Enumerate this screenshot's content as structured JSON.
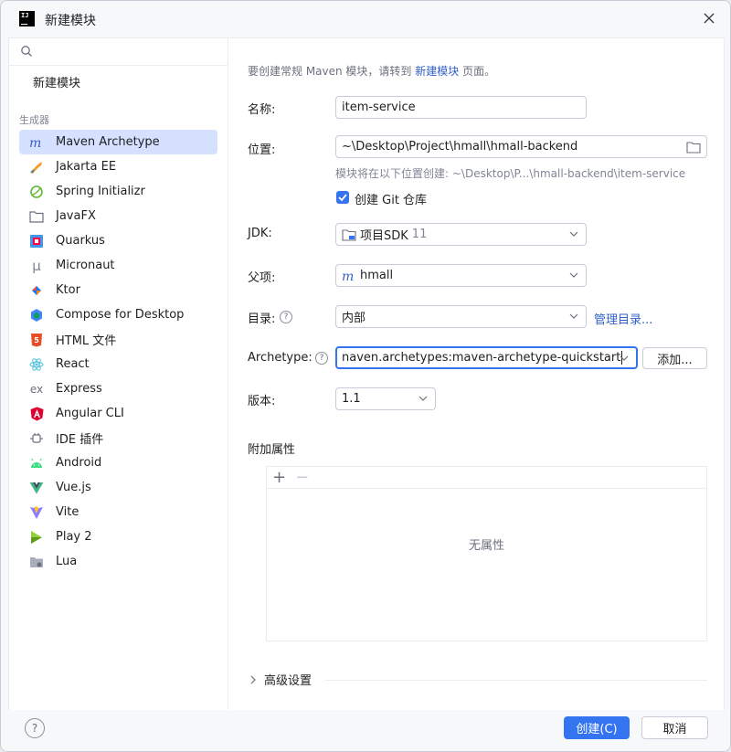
{
  "window": {
    "title": "新建模块",
    "app_icon": "IJ"
  },
  "sidebar": {
    "search_placeholder": "",
    "new_module": "新建模块",
    "section_label": "生成器",
    "items": [
      {
        "label": "Maven Archetype",
        "icon": "maven-icon",
        "selected": true
      },
      {
        "label": "Jakarta EE",
        "icon": "jakarta-icon"
      },
      {
        "label": "Spring Initializr",
        "icon": "spring-icon"
      },
      {
        "label": "JavaFX",
        "icon": "folder-icon"
      },
      {
        "label": "Quarkus",
        "icon": "quarkus-icon"
      },
      {
        "label": "Micronaut",
        "icon": "micronaut-icon"
      },
      {
        "label": "Ktor",
        "icon": "ktor-icon"
      },
      {
        "label": "Compose for Desktop",
        "icon": "compose-icon"
      },
      {
        "label": "HTML 文件",
        "icon": "html5-icon"
      },
      {
        "label": "React",
        "icon": "react-icon"
      },
      {
        "label": "Express",
        "icon": "express-icon"
      },
      {
        "label": "Angular CLI",
        "icon": "angular-icon"
      },
      {
        "label": "IDE 插件",
        "icon": "plugin-icon"
      },
      {
        "label": "Android",
        "icon": "android-icon"
      },
      {
        "label": "Vue.js",
        "icon": "vue-icon"
      },
      {
        "label": "Vite",
        "icon": "vite-icon"
      },
      {
        "label": "Play 2",
        "icon": "play-icon"
      },
      {
        "label": "Lua",
        "icon": "lua-folder-icon"
      }
    ]
  },
  "main": {
    "hint_prefix": "要创建常规 Maven 模块，请转到 ",
    "hint_link": "新建模块",
    "hint_suffix": " 页面。",
    "name_label": "名称:",
    "name_value": "item-service",
    "location_label": "位置:",
    "location_value": "~\\Desktop\\Project\\hmall\\hmall-backend",
    "location_hint": "模块将在以下位置创建: ~\\Desktop\\P...\\hmall-backend\\item-service",
    "git_checkbox_label": "创建 Git 仓库",
    "git_checked": true,
    "jdk_label": "JDK:",
    "jdk_value": "项目SDK",
    "jdk_version": "11",
    "parent_label": "父项:",
    "parent_value": "hmall",
    "catalog_label": "目录:",
    "catalog_value": "内部",
    "catalog_link": "管理目录...",
    "archetype_label": "Archetype:",
    "archetype_value": "naven.archetypes:maven-archetype-quickstart",
    "add_button": "添加...",
    "version_label": "版本:",
    "version_value": "1.1",
    "props_title": "附加属性",
    "props_empty": "无属性",
    "advanced_label": "高级设置"
  },
  "footer": {
    "help": "?",
    "create_button": "创建(C)",
    "cancel_button": "取消"
  },
  "colors": {
    "accent": "#3574f0",
    "selection": "#d5e1ff",
    "link": "#2f5fc8"
  }
}
